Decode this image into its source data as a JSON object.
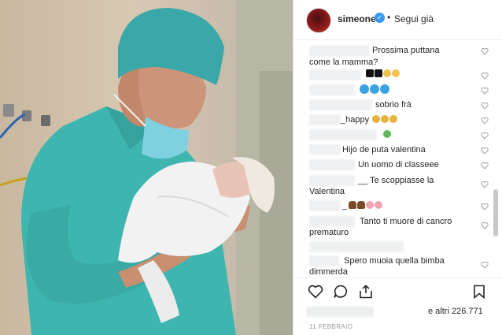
{
  "header": {
    "username": "simeone",
    "verified_symbol": "✓",
    "separator": "•",
    "follow_label": "Segui già"
  },
  "comments": [
    {
      "text": "Prossima puttana",
      "text2": "come la mamma?"
    },
    {
      "text": "",
      "emojis": [
        "black-heart",
        "black-heart",
        "face-emoji",
        "face-emoji"
      ]
    },
    {
      "text": "",
      "emojis": [
        "blue-circle",
        "blue-circle",
        "blue-circle"
      ]
    },
    {
      "text": "sobrio frà"
    },
    {
      "text": "_happy",
      "emojis": [
        "face-emoji",
        "face-emoji",
        "face-emoji"
      ]
    },
    {
      "text": "",
      "emojis": [
        "green-face-emoji"
      ]
    },
    {
      "text": "Hijo de puta valentina"
    },
    {
      "text": "Un uomo di classeee"
    },
    {
      "text": "__ Te scoppiasse la",
      "text2": "Valentina"
    },
    {
      "text": "_",
      "emojis": [
        "poop-emoji",
        "poop-emoji",
        "pig-emoji",
        "pig-emoji"
      ]
    },
    {
      "text": "Tanto ti muore di cancro",
      "text2": "prematuro"
    },
    {
      "text": "Spero muoia quella bimba",
      "text2": "dimmerda"
    }
  ],
  "likes": {
    "text": "e altri 226.771"
  },
  "date": "11 FEBBRAIO",
  "colors": {
    "verified": "#3897f0",
    "scrub": "#3fb5b0",
    "text": "#262626",
    "muted": "#999999"
  },
  "icons": [
    "heart-icon",
    "comment-icon",
    "share-icon",
    "bookmark-icon"
  ]
}
